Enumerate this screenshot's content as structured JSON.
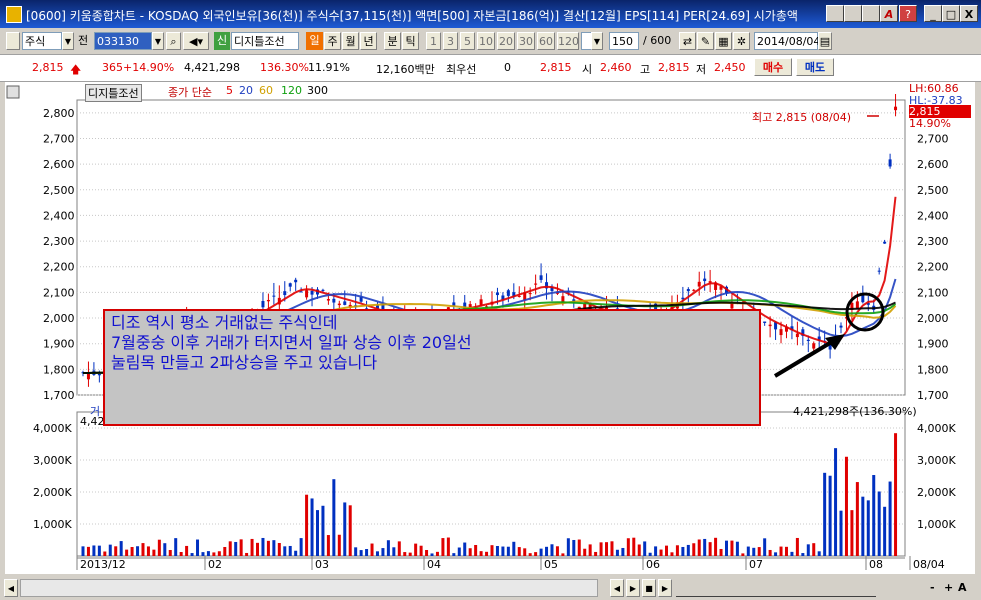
{
  "window": {
    "title": "[0600] 키움종합차트 - KOSDAQ 외국인보유[36(천)] 주식수[37,115(천)] 액면[500] 자본금[186(억)] 결산[12월] EPS[114] PER[24.69] 시가총액",
    "buttons": [
      "_",
      "□",
      "X"
    ]
  },
  "toolbar": {
    "market": "주식",
    "market_extra": "전",
    "code": "033130",
    "stock_name": "디지틀조선",
    "stock_badge": "신",
    "period_active": "일",
    "periods": [
      "주",
      "월",
      "년",
      "분",
      "틱"
    ],
    "intervals": [
      "1",
      "3",
      "5",
      "10",
      "20",
      "30",
      "60",
      "120"
    ],
    "count": "150",
    "count_total": "/ 600",
    "date": "2014/08/04"
  },
  "quote": {
    "price": "2,815",
    "change": "365",
    "change_pct": "+14.90%",
    "volume": "4,421,298",
    "vol_ratio": "136.30%",
    "turnover": "11.91%",
    "amount": "12,160백만",
    "best_label": "최우선",
    "best_value": "0",
    "best_price": "2,815",
    "open_label": "시",
    "open": "2,460",
    "high_label": "고",
    "high": "2,815",
    "low_label": "저",
    "low": "2,450",
    "buy": "매수",
    "sell": "매도"
  },
  "chart": {
    "stock_tag": "디지틀조선",
    "ma_label": "종가 단순",
    "ma_periods": [
      "5",
      "20",
      "60",
      "120",
      "300"
    ],
    "ma_colors": [
      "#e00000",
      "#2040c0",
      "#d0a000",
      "#10a010",
      "#000000"
    ],
    "high_marker": "최고 2,815 (08/04)",
    "right_info": {
      "lh": "LH:60.86",
      "hl": "HL:-37.83",
      "price": "2,815",
      "pct": "14.90%"
    },
    "volume_label": "거",
    "volume_value": "4,42",
    "volume_right": "4,421,298주(136.30%)",
    "price_ticks": [
      "2,800",
      "2,700",
      "2,600",
      "2,500",
      "2,400",
      "2,300",
      "2,200",
      "2,100",
      "2,000",
      "1,900",
      "1,800",
      "1,700"
    ],
    "volume_ticks": [
      "4,000K",
      "3,000K",
      "2,000K",
      "1,000K"
    ],
    "date_ticks": [
      "2013/12",
      "02",
      "03",
      "04",
      "05",
      "06",
      "07",
      "08",
      "08/04"
    ]
  },
  "chart_data": {
    "type": "candlestick",
    "x_range": [
      "2013/12",
      "2014/08/04"
    ],
    "ylim": [
      1700,
      2850
    ],
    "volume_ylim": [
      0,
      4500000
    ],
    "last": {
      "date": "2014/08/04",
      "open": 2460,
      "high": 2815,
      "low": 2450,
      "close": 2815,
      "volume": 4421298
    },
    "grid": true
  },
  "annotation": {
    "lines": [
      "디조 역시 평소 거래없는 주식인데",
      "7월중숭 이후 거래가 터지면서 일파 상승 이후 20일선",
      "눌림목 만들고 2파상승을 주고 있습니다"
    ]
  },
  "bottom": {
    "controls": [
      "◀",
      "▶",
      "■",
      "▶"
    ],
    "zoom": [
      "-",
      "+",
      "A"
    ]
  }
}
